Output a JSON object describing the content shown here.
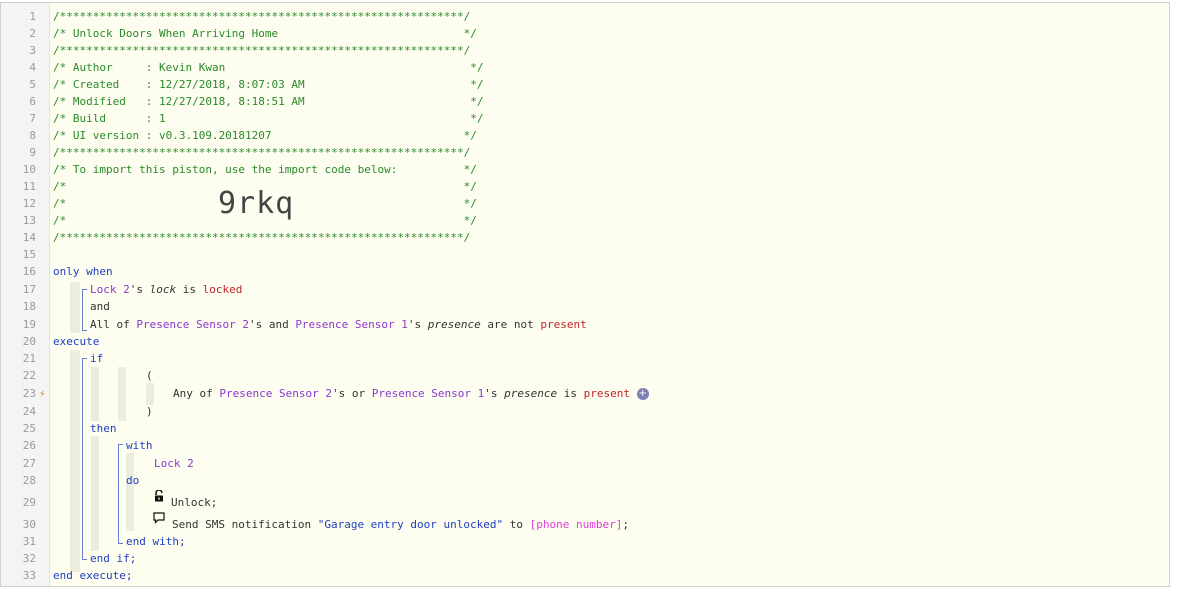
{
  "header": {
    "line1": "/*************************************************************/",
    "line2": "/* Unlock Doors When Arriving Home                            */",
    "line3": "/*************************************************************/",
    "line4": "/* Author     : Kevin Kwan                                     */",
    "line5": "/* Created    : 12/27/2018, 8:07:03 AM                         */",
    "line6": "/* Modified   : 12/27/2018, 8:18:51 AM                         */",
    "line7": "/* Build      : 1                                              */",
    "line8": "/* UI version : v0.3.109.20181207                             */",
    "line9": "/*************************************************************/",
    "line10": "/* To import this piston, use the import code below:          */",
    "line11": "/*                                                            */",
    "line12": "/*                                                            */",
    "line13": "/*                                                            */",
    "line14": "/*************************************************************/",
    "import_code": "9rkq"
  },
  "lines": {
    "only_when": "only when",
    "c17_dev": "Lock 2",
    "c17_s": "'s ",
    "c17_attr": "lock",
    "c17_is": " is ",
    "c17_val": "locked",
    "c18": "and",
    "c19_pre": "All of ",
    "c19_dev1": "Presence Sensor 2",
    "c19_and": "'s and ",
    "c19_dev2": "Presence Sensor 1",
    "c19_s": "'s ",
    "c19_attr": "presence",
    "c19_are": " are not ",
    "c19_val": "present",
    "execute": "execute",
    "if": "if",
    "open_paren": "(",
    "c23_pre": "Any of ",
    "c23_dev1": "Presence Sensor 2",
    "c23_or": "'s or ",
    "c23_dev2": "Presence Sensor 1",
    "c23_s": "'s ",
    "c23_attr": "presence",
    "c23_is": " is ",
    "c23_val": "present",
    "close_paren": ")",
    "then": "then",
    "with": "with",
    "c27_dev": "Lock 2",
    "do": "do",
    "c29": "Unlock;",
    "c30_pre": "Send SMS notification ",
    "c30_str": "\"Garage entry door unlocked\"",
    "c30_to": " to ",
    "c30_var": "[phone number]",
    "c30_end": ";",
    "end_with": "end with;",
    "end_if": "end if;",
    "end_execute": "end execute;"
  },
  "line_numbers": [
    "1",
    "2",
    "3",
    "4",
    "5",
    "6",
    "7",
    "8",
    "9",
    "10",
    "11",
    "12",
    "13",
    "14",
    "15",
    "16",
    "17",
    "18",
    "19",
    "20",
    "21",
    "22",
    "23",
    "24",
    "25",
    "26",
    "27",
    "28",
    "29",
    "30",
    "31",
    "32",
    "33"
  ],
  "icons": {
    "condition_trigger": "lightning-bolt-icon",
    "add": "plus-icon",
    "unlock": "unlocked-padlock-icon",
    "notification": "speech-bubble-icon"
  },
  "colors": {
    "comment": "#2a8a2a",
    "keyword": "#1f3fbf",
    "device": "#8a39d0",
    "value": "#c0262b",
    "variable": "#e03be0"
  }
}
